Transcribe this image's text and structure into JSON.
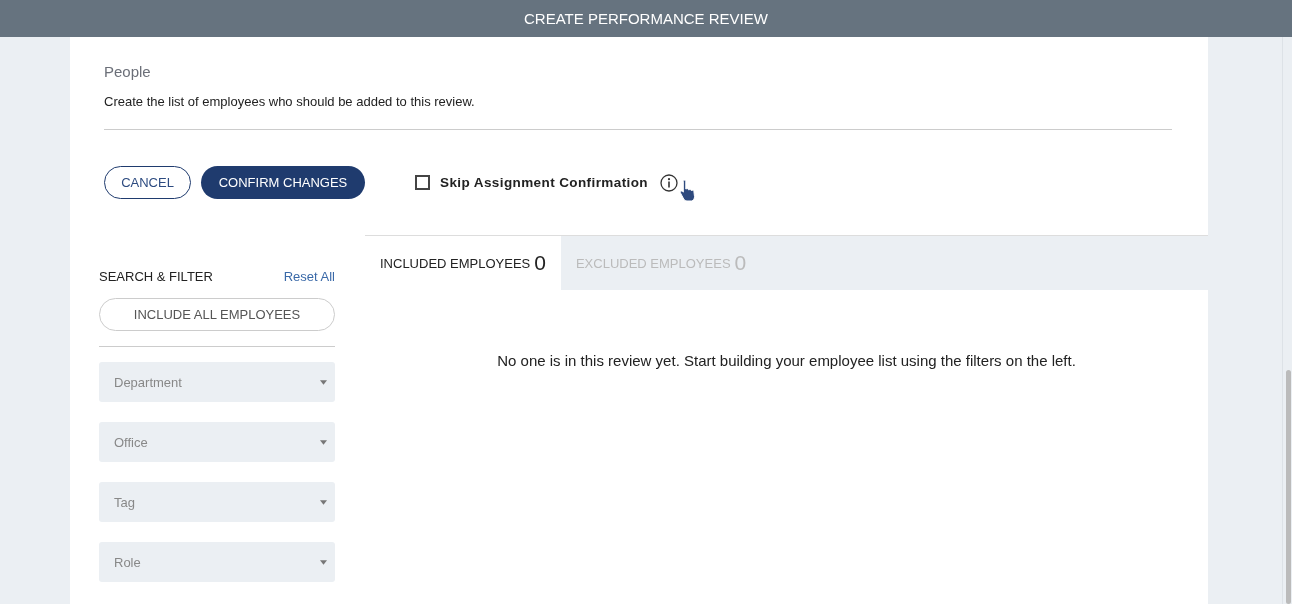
{
  "header": {
    "title": "CREATE PERFORMANCE REVIEW"
  },
  "section": {
    "title": "People",
    "description": "Create the list of employees who should be added to this review."
  },
  "actions": {
    "cancel": "CANCEL",
    "confirm": "CONFIRM CHANGES"
  },
  "skip_confirmation": {
    "label": "Skip Assignment Confirmation",
    "checked": false
  },
  "filters": {
    "title": "SEARCH & FILTER",
    "reset": "Reset All",
    "include_all": "INCLUDE ALL EMPLOYEES",
    "dropdowns": [
      {
        "placeholder": "Department"
      },
      {
        "placeholder": "Office"
      },
      {
        "placeholder": "Tag"
      },
      {
        "placeholder": "Role"
      }
    ]
  },
  "tabs": [
    {
      "label": "INCLUDED EMPLOYEES",
      "count": "0",
      "selected": true
    },
    {
      "label": "EXCLUDED EMPLOYEES",
      "count": "0",
      "selected": false
    }
  ],
  "empty_message": "No one is in this review yet. Start building your employee list using the filters on the left."
}
